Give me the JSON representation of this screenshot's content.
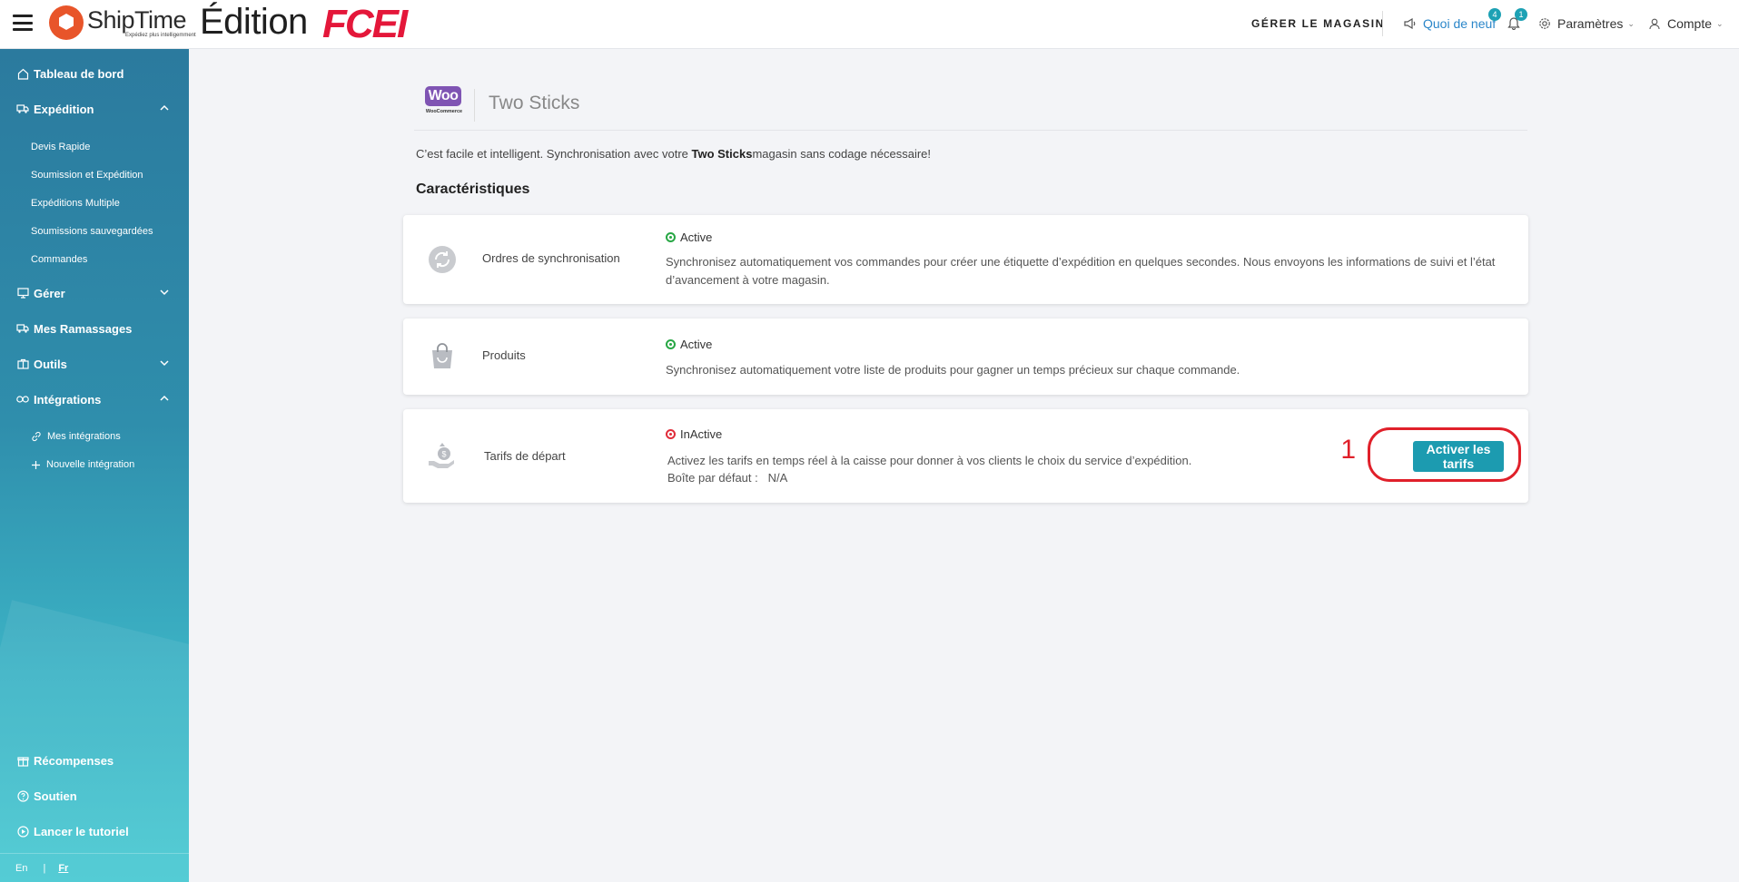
{
  "header": {
    "logo_name": "ShipTime",
    "logo_tagline": "Expédiez plus intelligemment",
    "edition_label": "Édition",
    "edition_brand": "FCEI",
    "manage_store": "GÉRER LE MAGASIN",
    "whats_new": "Quoi de neuf",
    "whats_new_badge": "4",
    "notifications_badge": "1",
    "settings": "Paramètres",
    "account": "Compte"
  },
  "sidebar": {
    "dashboard": "Tableau de bord",
    "shipping": "Expédition",
    "shipping_items": [
      "Devis Rapide",
      "Soumission et Expédition",
      "Expéditions Multiple",
      "Soumissions sauvegardées",
      "Commandes"
    ],
    "manage": "Gérer",
    "pickups": "Mes Ramassages",
    "tools": "Outils",
    "integrations": "Intégrations",
    "integrations_items": [
      "Mes intégrations",
      "Nouvelle intégration"
    ],
    "rewards": "Récompenses",
    "support": "Soutien",
    "tutorial": "Lancer le tutoriel",
    "lang_en": "En",
    "lang_sep": "|",
    "lang_fr": "Fr"
  },
  "store": {
    "platform_logo": "Woo",
    "platform_sub": "WooCommerce",
    "name": "Two Sticks",
    "intro_before": "C’est facile et intelligent. Synchronisation avec votre ",
    "intro_store": "Two Sticks",
    "intro_after": "magasin sans codage nécessaire!"
  },
  "features_title": "Caractéristiques",
  "features": [
    {
      "icon": "sync-icon",
      "name": "Ordres de synchronisation",
      "status": "Active",
      "description": "Synchronisez automatiquement vos commandes pour créer une étiquette d’expédition en quelques secondes. Nous envoyons les informations de suivi et l’état d’avancement à votre magasin."
    },
    {
      "icon": "shopping-bag-icon",
      "name": "Produits",
      "status": "Active",
      "description": "Synchronisez automatiquement votre liste de produits pour gagner un temps précieux sur chaque commande."
    },
    {
      "icon": "money-bag-hand-icon",
      "name": "Tarifs de départ",
      "status": "InActive",
      "description": "Activez les tarifs en temps réel à la caisse pour donner à vos clients le choix du service d’expédition.",
      "default_box_label": "Boîte par défaut :",
      "default_box_value": "N/A",
      "action": "Activer les tarifs",
      "annotation_number": "1"
    }
  ],
  "colors": {
    "sidebar_top": "#2b7a9e",
    "sidebar_bottom": "#48c9d2",
    "accent": "#1c9bb0",
    "active_status": "#28a745",
    "inactive_status": "#e02d3a",
    "annotation": "#e0202a",
    "brand_red": "#e4173a"
  }
}
